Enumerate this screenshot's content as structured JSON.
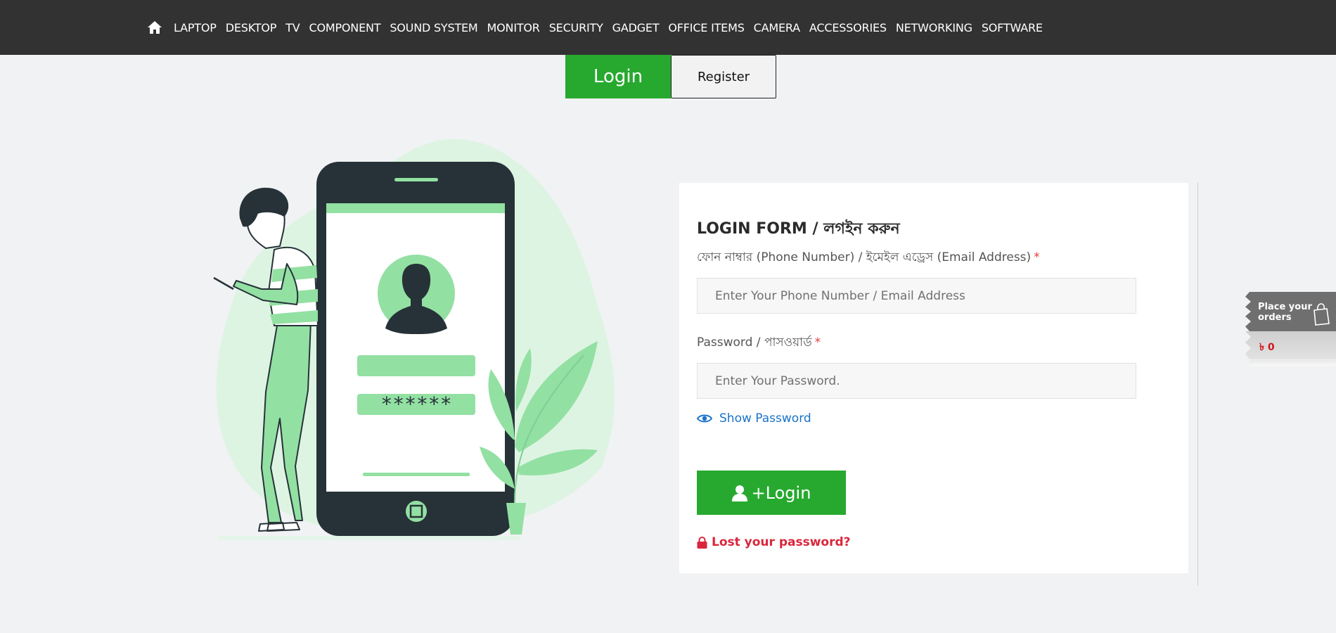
{
  "nav": {
    "home_icon": "home-icon",
    "items": [
      "LAPTOP",
      "DESKTOP",
      "TV",
      "COMPONENT",
      "SOUND SYSTEM",
      "MONITOR",
      "SECURITY",
      "GADGET",
      "OFFICE ITEMS",
      "CAMERA",
      "ACCESSORIES",
      "NETWORKING",
      "SOFTWARE"
    ]
  },
  "tabs": {
    "login": "Login",
    "register": "Register"
  },
  "illustration": {
    "password_mask": "******"
  },
  "form": {
    "title": "LOGIN FORM / লগইন করুন",
    "phone_label": "ফোন নাম্বার (Phone Number) / ইমেইল এড্রেস (Email Address)",
    "phone_placeholder": "Enter Your Phone Number / Email Address",
    "password_label": "Password / পাসওয়ার্ড",
    "password_placeholder": "Enter Your Password.",
    "required_mark": "*",
    "show_password": "Show Password",
    "login_button": "+Login",
    "lost_password": "Lost your password?"
  },
  "order_widget": {
    "line1": "Place your",
    "line2": "orders",
    "amount": "৳ 0"
  },
  "colors": {
    "accent": "#27a92f",
    "nav_bg": "#323232",
    "link": "#1a73c9",
    "danger": "#d9263c"
  }
}
